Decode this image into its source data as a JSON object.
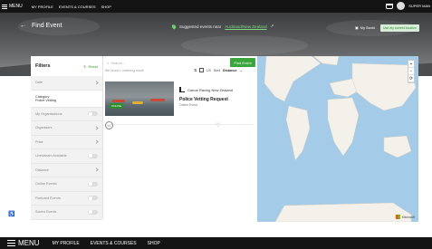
{
  "topbar": {
    "menu_label": "MENU",
    "nav": [
      "MY PROFILE",
      "EVENTS & COURSES",
      "SHOP"
    ],
    "user_label": "SUPER MAN"
  },
  "hero": {
    "back_label": "Find Event",
    "suggest_text": "Suggested events near",
    "location": "Auckland/New Zealand",
    "my_bookings": "My Booki",
    "use_location": "Use my current location"
  },
  "filters": {
    "title": "Filters",
    "reset": "Reset",
    "rows": [
      {
        "label": "Date",
        "control": "chevron"
      },
      {
        "label": "Category",
        "value": "Police Vetting",
        "control": "chevron",
        "selected": true
      },
      {
        "label": "My Organisations",
        "control": "toggle"
      },
      {
        "label": "Organisers",
        "control": "chevron"
      },
      {
        "label": "Price",
        "control": "chevron"
      },
      {
        "label": "Livestream Available",
        "control": "toggle"
      },
      {
        "label": "Distance",
        "control": "chevron"
      },
      {
        "label": "Online Events",
        "control": "toggle"
      },
      {
        "label": "Featured Events",
        "control": "toggle"
      },
      {
        "label": "Saved Events",
        "control": "toggle"
      }
    ]
  },
  "results": {
    "search_placeholder": "Search...",
    "find_button": "Find Event",
    "subline": "We found 1 matching result",
    "count_label": "LS",
    "sort_label": "Sort",
    "sort_value": "Distance",
    "event": {
      "organiser": "Canoe Racing New Zealand",
      "title": "Police Vetting Request",
      "subtitle": "Online Event",
      "badge": "ONLINE",
      "rating": "0%"
    }
  },
  "map": {
    "zoom_in": "+",
    "zoom_out": "−",
    "reset": "⟳",
    "brand": "Microsoft"
  },
  "bottombar": {
    "menu_label": "MENU",
    "nav": [
      "MY PROFILE",
      "EVENTS & COURSES",
      "SHOP"
    ]
  },
  "colors": {
    "accent": "#3ba63b",
    "topbar": "#141414",
    "map_water": "#a4cbe8",
    "map_land": "#f4f1ea"
  }
}
